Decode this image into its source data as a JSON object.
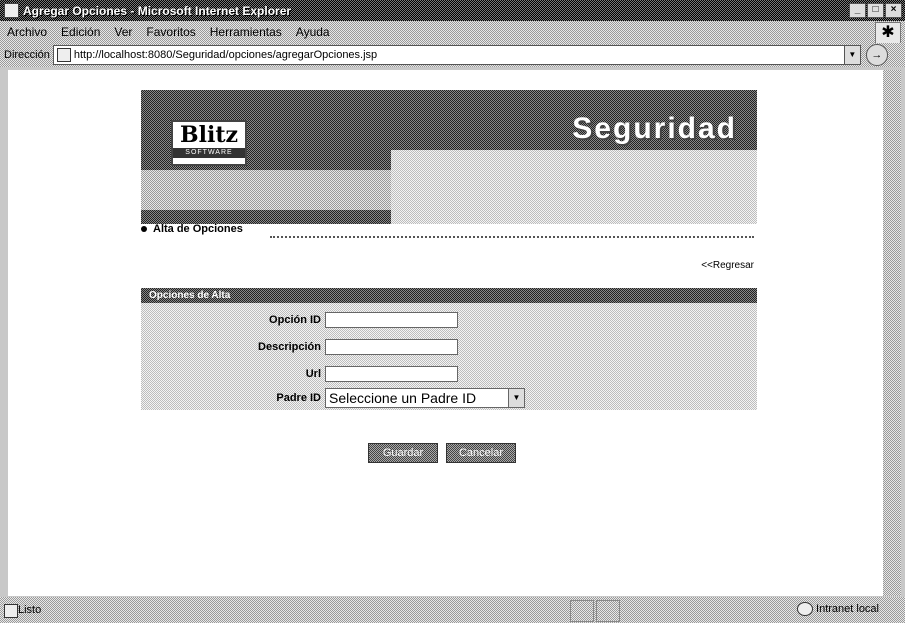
{
  "window": {
    "title": "Agregar Opciones - Microsoft Internet Explorer",
    "controls": [
      "_",
      "□",
      "×"
    ]
  },
  "menubar": {
    "items": [
      "Archivo",
      "Edición",
      "Ver",
      "Favoritos",
      "Herramientas",
      "Ayuda"
    ]
  },
  "addressbar": {
    "label": "Dirección",
    "url": "http://localhost:8080/Seguridad/opciones/agregarOpciones.jsp",
    "go_label": "→"
  },
  "banner": {
    "logo_text": "Blitz",
    "logo_sub": "SOFTWARE",
    "headline": "Seguridad"
  },
  "page": {
    "section_title": "Alta de Opciones",
    "back_link": "<<Regresar"
  },
  "form": {
    "header": "Opciones de Alta",
    "fields": [
      {
        "label": "Opción ID",
        "value": ""
      },
      {
        "label": "Descripción",
        "value": ""
      },
      {
        "label": "Url",
        "value": ""
      }
    ],
    "parent": {
      "label": "Padre ID",
      "selected": "Seleccione un Padre ID"
    },
    "buttons": {
      "submit": "Guardar",
      "cancel": "Cancelar"
    }
  },
  "statusbar": {
    "text": "Listo",
    "zone": "Intranet local"
  }
}
